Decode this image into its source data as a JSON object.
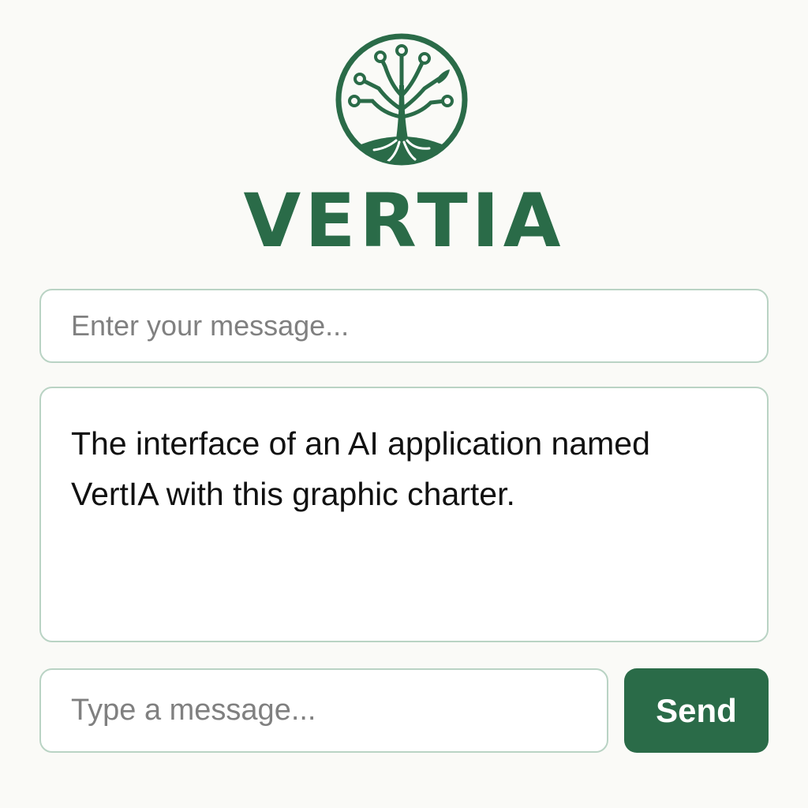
{
  "app": {
    "name": "VERTIA",
    "logo_icon": "tree-circuit-logo-icon"
  },
  "colors": {
    "brand": "#2a6b48",
    "border": "#b9d3c4",
    "background": "#fafaf7"
  },
  "message_input": {
    "placeholder": "Enter your message...",
    "value": ""
  },
  "response": {
    "text": "The interface of an AI application named VertIA with this graphic charter."
  },
  "composer": {
    "placeholder": "Type a message...",
    "value": "",
    "send_label": "Send"
  }
}
